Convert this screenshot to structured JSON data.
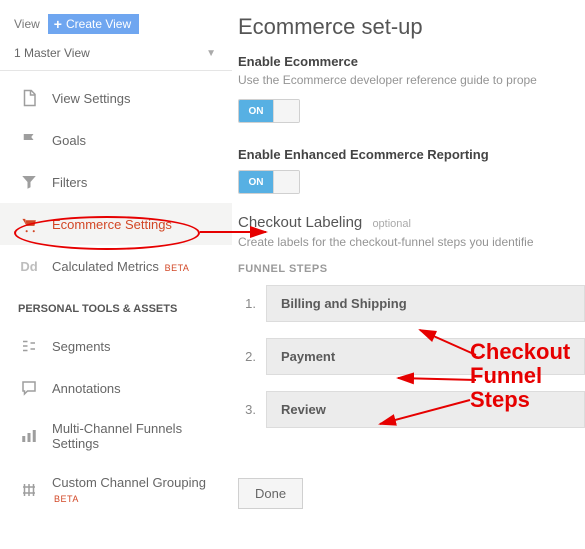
{
  "topbar": {
    "view_label": "View",
    "create_view_label": "Create View"
  },
  "master_view": "1 Master View",
  "sidebar": {
    "items": [
      {
        "label": "View Settings"
      },
      {
        "label": "Goals"
      },
      {
        "label": "Filters"
      },
      {
        "label": "Ecommerce Settings"
      },
      {
        "label": "Calculated Metrics",
        "beta": "BETA"
      }
    ],
    "section_title": "PERSONAL TOOLS & ASSETS",
    "tools": [
      {
        "label": "Segments"
      },
      {
        "label": "Annotations"
      },
      {
        "label": "Multi-Channel Funnels Settings"
      },
      {
        "label": "Custom Channel Grouping",
        "beta": "BETA"
      }
    ]
  },
  "main": {
    "title": "Ecommerce set-up",
    "enable_ecom_h": "Enable Ecommerce",
    "enable_ecom_help": "Use the Ecommerce developer reference guide to prope",
    "toggle_on": "ON",
    "enhanced_h": "Enable Enhanced Ecommerce Reporting",
    "checkout_h": "Checkout Labeling",
    "checkout_opt": "optional",
    "checkout_help": "Create labels for the checkout-funnel steps you identifie",
    "funnel_label": "FUNNEL STEPS",
    "steps": [
      {
        "num": "1.",
        "label": "Billing and Shipping"
      },
      {
        "num": "2.",
        "label": "Payment"
      },
      {
        "num": "3.",
        "label": "Review"
      }
    ],
    "done_label": "Done"
  },
  "annotation": {
    "label_l1": "Checkout",
    "label_l2": "Funnel",
    "label_l3": "Steps"
  }
}
